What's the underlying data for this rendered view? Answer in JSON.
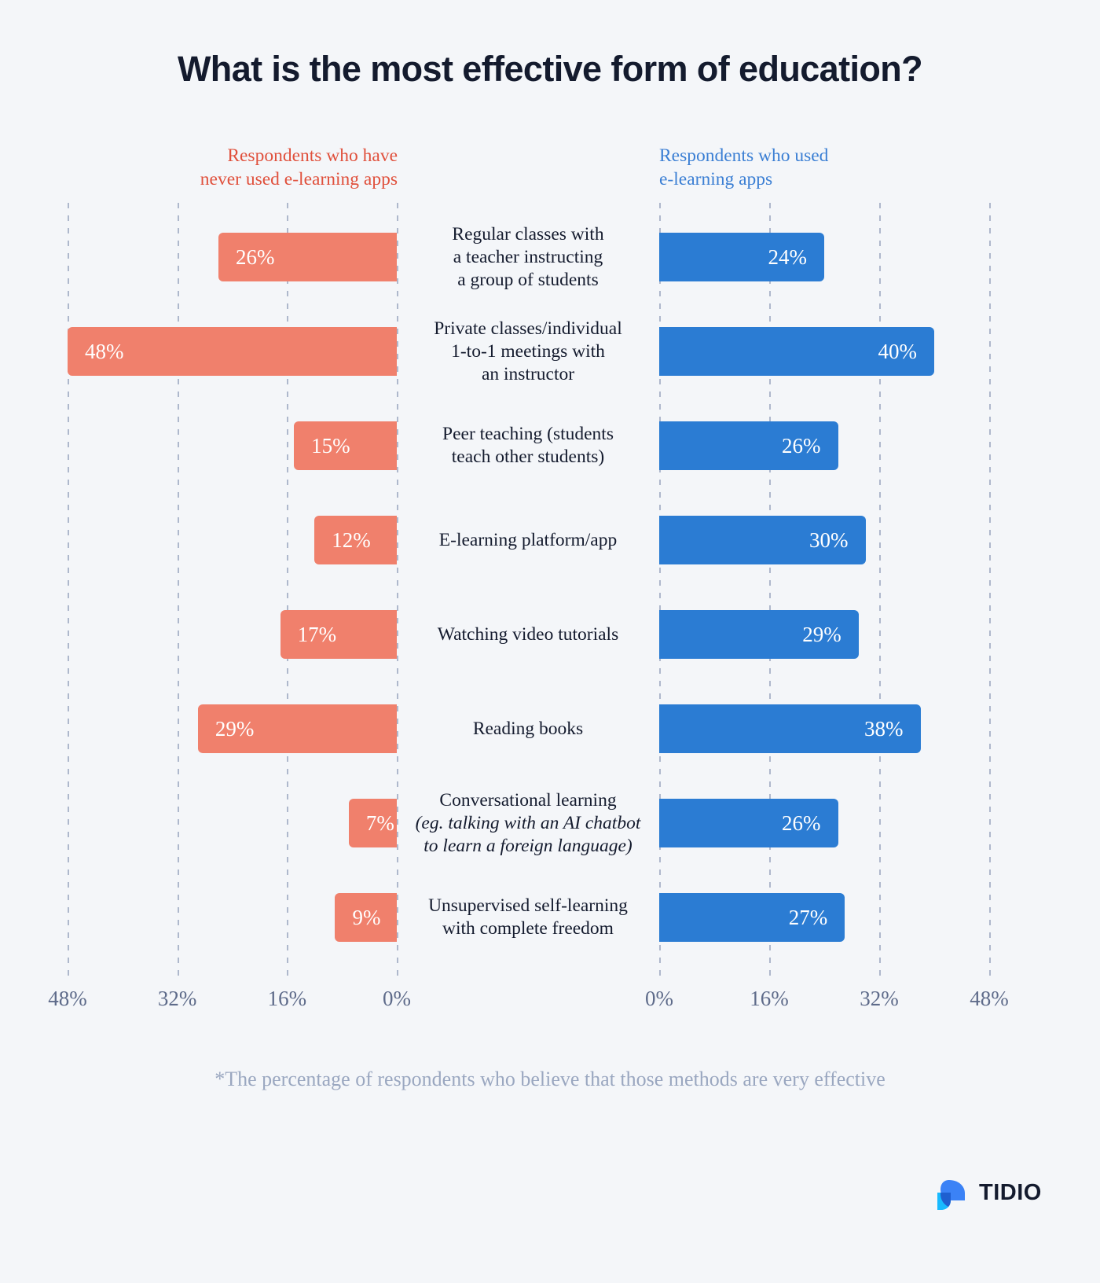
{
  "title": "What is the most effective form of education?",
  "legend": {
    "left": {
      "line1": "Respondents who have",
      "line2": "never used e-learning apps",
      "color": "#e0503c"
    },
    "right": {
      "line1": "Respondents who used",
      "line2": "e-learning apps",
      "color": "#3b7fd4"
    }
  },
  "axis": {
    "left_ticks": [
      "48%",
      "32%",
      "16%",
      "0%"
    ],
    "right_ticks": [
      "0%",
      "16%",
      "32%",
      "48%"
    ]
  },
  "footnote": "*The percentage of respondents who believe that those methods are very effective",
  "logo": {
    "text": "TIDIO",
    "mark": "tidio-chat-bubble-icon",
    "color_primary": "#3b82f6",
    "color_secondary": "#18baff"
  },
  "colors": {
    "background": "#f4f6f9",
    "bar_left": "#f0806c",
    "bar_right": "#2b7cd3",
    "gridline": "#aeb8cc",
    "text_dark": "#141b2e",
    "tick_text": "#5e6b8a",
    "footnote_text": "#9aa7c0"
  },
  "chart_data": {
    "type": "bar",
    "title": "What is the most effective form of education?",
    "subtitle": "*The percentage of respondents who believe that those methods are very effective",
    "orientation": "horizontal-diverging",
    "xlabel": "",
    "ylabel": "",
    "xlim": [
      0,
      48
    ],
    "xticks": [
      0,
      16,
      32,
      48
    ],
    "grid": true,
    "legend_position": "top",
    "value_suffix": "%",
    "categories": [
      "Regular classes with a teacher  instructing a group of students",
      "Private classes/individual 1-to-1 meetings with an instructor",
      "Peer teaching (students teach other students)",
      "E-learning platform/app",
      "Watching video tutorials",
      "Reading books",
      "Conversational learning (eg. talking with an AI chatbot to learn a foreign language)",
      "Unsupervised self-learning with complete freedom"
    ],
    "series": [
      {
        "name": "Respondents who have never used e-learning apps",
        "color": "#f0806c",
        "side": "left",
        "values": [
          26,
          48,
          15,
          12,
          17,
          29,
          7,
          9
        ],
        "labels": [
          "26%",
          "48%",
          "15%",
          "12%",
          "17%",
          "29%",
          "7%",
          "9%"
        ]
      },
      {
        "name": "Respondents who used e-learning apps",
        "color": "#2b7cd3",
        "side": "right",
        "values": [
          24,
          40,
          26,
          30,
          29,
          38,
          26,
          27
        ],
        "labels": [
          "24%",
          "40%",
          "26%",
          "30%",
          "29%",
          "38%",
          "26%",
          "27%"
        ]
      }
    ]
  },
  "rows": [
    {
      "label_lines": [
        "Regular classes with",
        "a teacher  instructing",
        "a group of students"
      ],
      "italic_lines": [],
      "left": {
        "value": 26,
        "label": "26%"
      },
      "right": {
        "value": 24,
        "label": "24%"
      }
    },
    {
      "label_lines": [
        "Private classes/individual",
        "1-to-1 meetings with",
        "an instructor"
      ],
      "italic_lines": [],
      "left": {
        "value": 48,
        "label": "48%"
      },
      "right": {
        "value": 40,
        "label": "40%"
      }
    },
    {
      "label_lines": [
        "Peer teaching (students",
        "teach other students)"
      ],
      "italic_lines": [],
      "left": {
        "value": 15,
        "label": "15%"
      },
      "right": {
        "value": 26,
        "label": "26%"
      }
    },
    {
      "label_lines": [
        "E-learning platform/app"
      ],
      "italic_lines": [],
      "left": {
        "value": 12,
        "label": "12%"
      },
      "right": {
        "value": 30,
        "label": "30%"
      }
    },
    {
      "label_lines": [
        "Watching video tutorials"
      ],
      "italic_lines": [],
      "left": {
        "value": 17,
        "label": "17%"
      },
      "right": {
        "value": 29,
        "label": "29%"
      }
    },
    {
      "label_lines": [
        "Reading books"
      ],
      "italic_lines": [],
      "left": {
        "value": 29,
        "label": "29%"
      },
      "right": {
        "value": 38,
        "label": "38%"
      }
    },
    {
      "label_lines": [
        "Conversational learning"
      ],
      "italic_lines": [
        "(eg. talking with an AI chatbot",
        "to learn a foreign language)"
      ],
      "left": {
        "value": 7,
        "label": "7%"
      },
      "right": {
        "value": 26,
        "label": "26%"
      }
    },
    {
      "label_lines": [
        "Unsupervised self-learning",
        "with complete freedom"
      ],
      "italic_lines": [],
      "left": {
        "value": 9,
        "label": "9%"
      },
      "right": {
        "value": 27,
        "label": "27%"
      }
    }
  ]
}
